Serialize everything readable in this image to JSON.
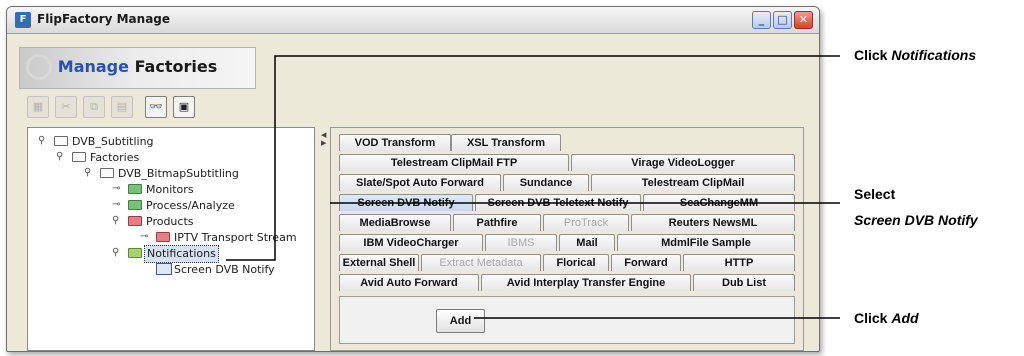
{
  "window": {
    "title": "FlipFactory Manage",
    "app_icon": "ff-icon",
    "controls": {
      "minimize": "_",
      "maximize": "□",
      "close": "✕"
    }
  },
  "banner": {
    "title_accent": "Manage",
    "title_rest": "Factories"
  },
  "toolbar": {
    "tools": [
      {
        "name": "new-icon",
        "glyph": "▦",
        "enabled": false
      },
      {
        "name": "cut-icon",
        "glyph": "✂",
        "enabled": false
      },
      {
        "name": "copy-icon",
        "glyph": "⧉",
        "enabled": false
      },
      {
        "name": "paste-icon",
        "glyph": "▤",
        "enabled": false
      },
      {
        "name": "binoculars-icon",
        "glyph": "👓",
        "enabled": true
      },
      {
        "name": "save-icon",
        "glyph": "▣",
        "enabled": true
      }
    ]
  },
  "tree": {
    "items": [
      {
        "label": "DVB_Subtitling",
        "toggle": "⚲",
        "icon": "folder-icon",
        "color": "white",
        "selected": false
      },
      {
        "label": "Factories",
        "toggle": "⚲",
        "icon": "folder-icon",
        "color": "white",
        "selected": false
      },
      {
        "label": "DVB_BitmapSubtitling",
        "toggle": "⚲",
        "icon": "folder-icon",
        "color": "white",
        "selected": false
      },
      {
        "label": "Monitors",
        "toggle": "⊸",
        "icon": "folder-icon",
        "color": "green",
        "selected": false
      },
      {
        "label": "Process/Analyze",
        "toggle": "⊸",
        "icon": "folder-icon",
        "color": "green",
        "selected": false
      },
      {
        "label": "Products",
        "toggle": "⚲",
        "icon": "folder-icon",
        "color": "red",
        "selected": false
      },
      {
        "label": "IPTV Transport Stream",
        "toggle": "⊸",
        "icon": "folder-icon",
        "color": "red",
        "selected": false
      },
      {
        "label": "Notifications",
        "toggle": "⚲",
        "icon": "folder-icon",
        "color": "lime",
        "selected": true
      },
      {
        "label": "Screen DVB Notify",
        "toggle": "",
        "icon": "monitor-icon",
        "color": "blue",
        "selected": false
      }
    ]
  },
  "tabs": {
    "rows": [
      [
        {
          "label": "VOD Transform"
        },
        {
          "label": "XSL Transform"
        }
      ],
      [
        {
          "label": "Telestream ClipMail FTP"
        },
        {
          "label": "Virage VideoLogger"
        }
      ],
      [
        {
          "label": "Slate/Spot Auto Forward"
        },
        {
          "label": "Sundance"
        },
        {
          "label": "Telestream ClipMail"
        }
      ],
      [
        {
          "label": "Screen DVB Notify",
          "selected": true
        },
        {
          "label": "Screen DVB Teletext Notify"
        },
        {
          "label": "SeaChangeMM"
        }
      ],
      [
        {
          "label": "MediaBrowse"
        },
        {
          "label": "Pathfire"
        },
        {
          "label": "ProTrack",
          "disabled": true
        },
        {
          "label": "Reuters NewsML"
        }
      ],
      [
        {
          "label": "IBM VideoCharger"
        },
        {
          "label": "IBMS",
          "disabled": true
        },
        {
          "label": "Mail"
        },
        {
          "label": "MdmlFile Sample"
        }
      ],
      [
        {
          "label": "External Shell"
        },
        {
          "label": "Extract Metadata",
          "disabled": true
        },
        {
          "label": "Florical"
        },
        {
          "label": "Forward"
        },
        {
          "label": "HTTP"
        }
      ],
      [
        {
          "label": "Avid Auto Forward"
        },
        {
          "label": "Avid Interplay Transfer Engine"
        },
        {
          "label": "Dub List"
        }
      ]
    ]
  },
  "content": {
    "add_label": "Add"
  },
  "callouts": {
    "notifications": {
      "verb": "Click",
      "target": "Notifications"
    },
    "select": {
      "verb": "Select",
      "target": "Screen DVB Notify"
    },
    "add": {
      "verb": "Click",
      "target": "Add"
    }
  },
  "colors": {
    "selection": "#d7e2f4",
    "banner_accent": "#2b4fb8",
    "leader": "#000000"
  }
}
